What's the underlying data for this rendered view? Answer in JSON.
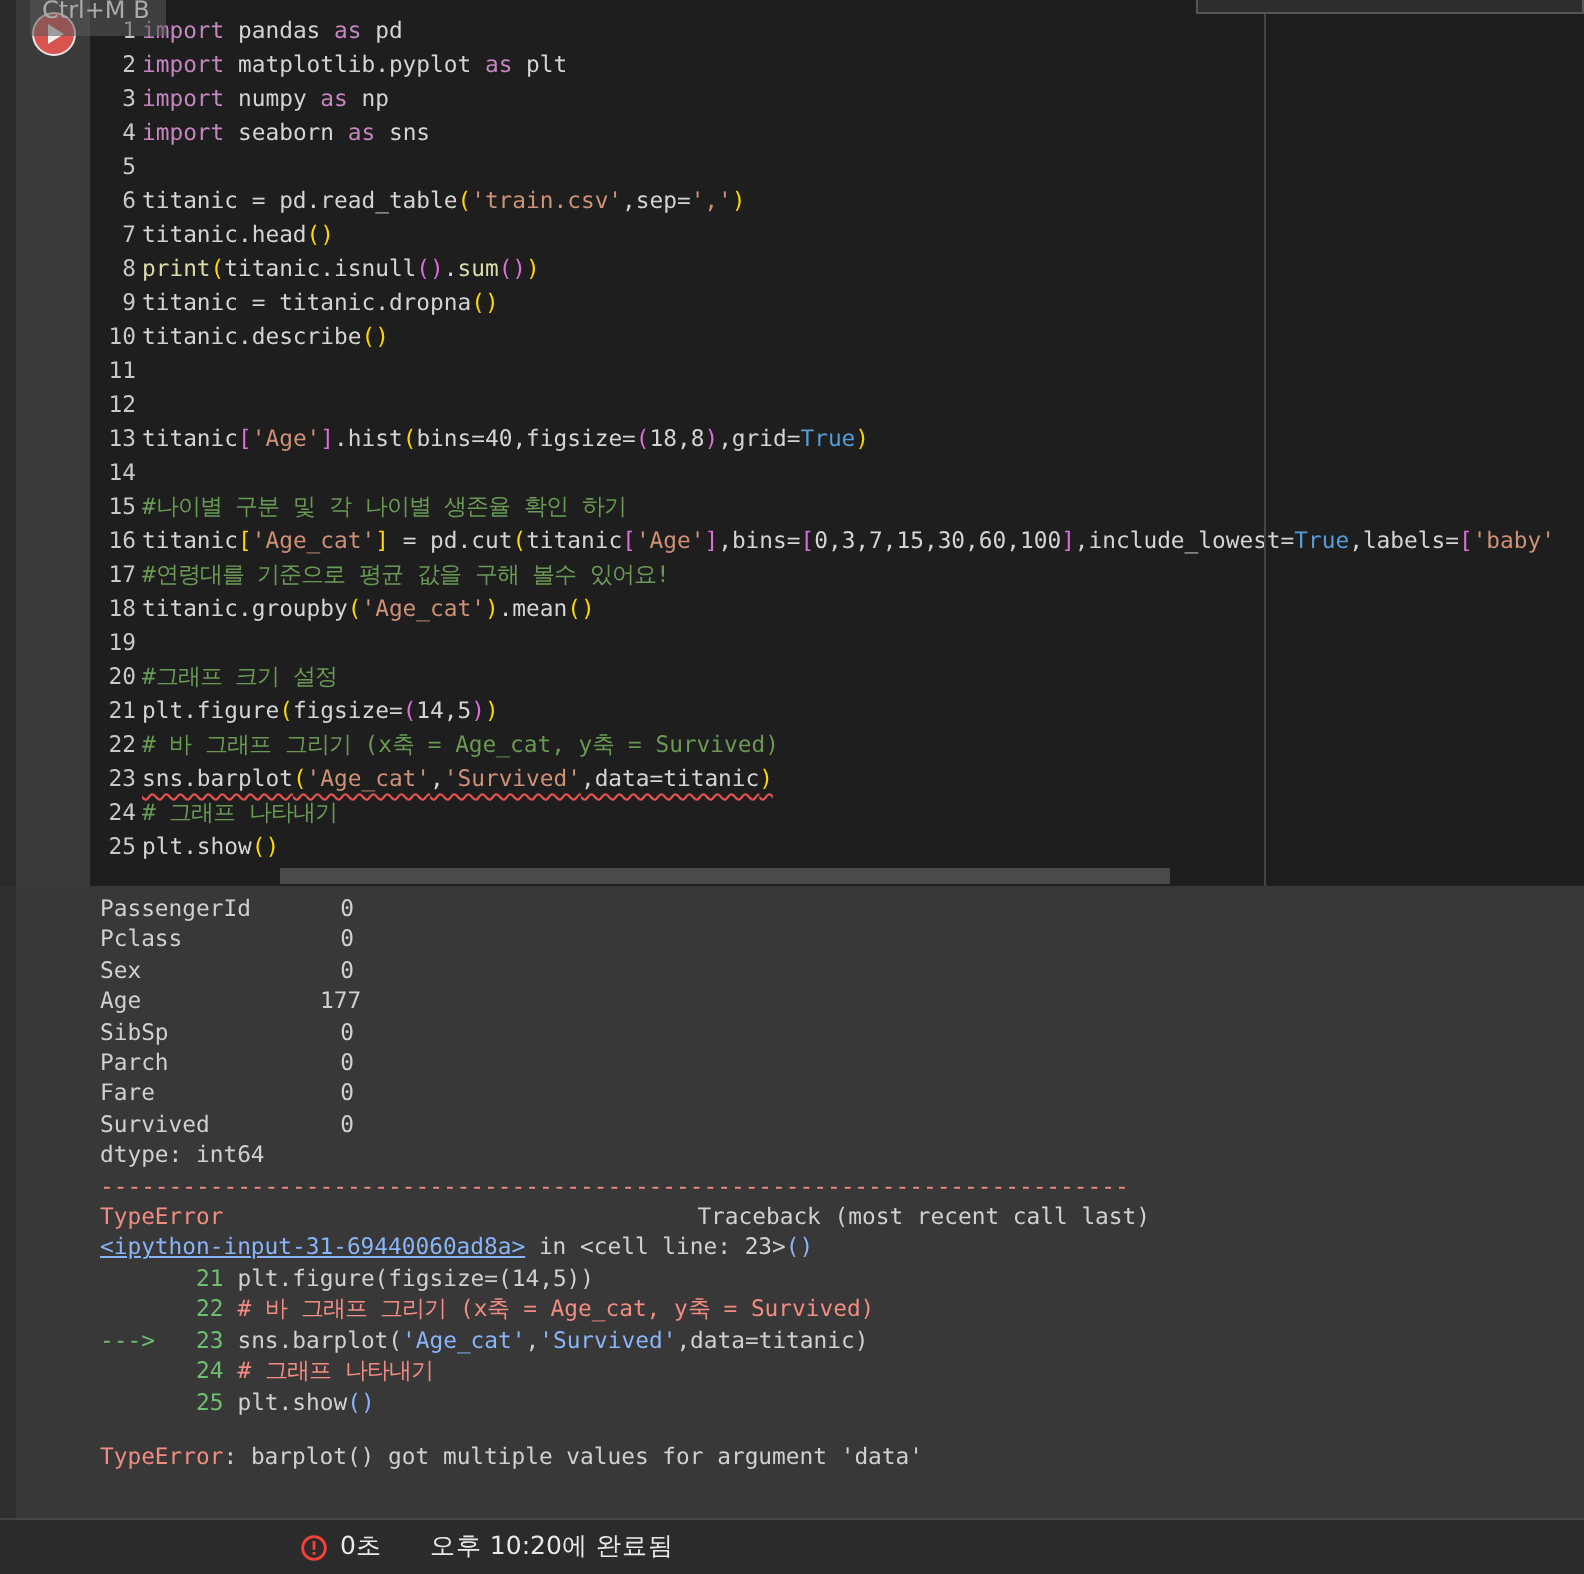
{
  "tooltip": "Ctrl+M B",
  "code_lines": [
    {
      "num": "1",
      "squiggle": false,
      "tokens": [
        {
          "kind": "kw",
          "text": "import"
        },
        {
          "kind": "plain",
          "text": " pandas "
        },
        {
          "kind": "kw",
          "text": "as"
        },
        {
          "kind": "plain",
          "text": " pd"
        }
      ]
    },
    {
      "num": "2",
      "squiggle": false,
      "tokens": [
        {
          "kind": "kw",
          "text": "import"
        },
        {
          "kind": "plain",
          "text": " matplotlib.pyplot "
        },
        {
          "kind": "kw",
          "text": "as"
        },
        {
          "kind": "plain",
          "text": " plt"
        }
      ]
    },
    {
      "num": "3",
      "squiggle": false,
      "tokens": [
        {
          "kind": "kw",
          "text": "import"
        },
        {
          "kind": "plain",
          "text": " numpy "
        },
        {
          "kind": "kw",
          "text": "as"
        },
        {
          "kind": "plain",
          "text": " np"
        }
      ]
    },
    {
      "num": "4",
      "squiggle": false,
      "tokens": [
        {
          "kind": "kw",
          "text": "import"
        },
        {
          "kind": "plain",
          "text": " seaborn "
        },
        {
          "kind": "kw",
          "text": "as"
        },
        {
          "kind": "plain",
          "text": " sns"
        }
      ]
    },
    {
      "num": "5"
    },
    {
      "num": "6",
      "squiggle": false,
      "tokens": [
        {
          "kind": "plain",
          "text": "titanic = pd.read_table"
        },
        {
          "kind": "p1",
          "text": "("
        },
        {
          "kind": "str",
          "text": "'train.csv'"
        },
        {
          "kind": "plain",
          "text": ",sep="
        },
        {
          "kind": "str",
          "text": "','"
        },
        {
          "kind": "p1",
          "text": ")"
        }
      ]
    },
    {
      "num": "7",
      "squiggle": false,
      "tokens": [
        {
          "kind": "plain",
          "text": "titanic.head"
        },
        {
          "kind": "p1",
          "text": "()"
        }
      ]
    },
    {
      "num": "8",
      "squiggle": false,
      "tokens": [
        {
          "kind": "fn",
          "text": "print"
        },
        {
          "kind": "p1",
          "text": "("
        },
        {
          "kind": "plain",
          "text": "titanic.isnull"
        },
        {
          "kind": "p2",
          "text": "()"
        },
        {
          "kind": "plain",
          "text": "."
        },
        {
          "kind": "fn",
          "text": "sum"
        },
        {
          "kind": "p2",
          "text": "()"
        },
        {
          "kind": "p1",
          "text": ")"
        }
      ]
    },
    {
      "num": "9",
      "squiggle": false,
      "tokens": [
        {
          "kind": "plain",
          "text": "titanic = titanic.dropna"
        },
        {
          "kind": "p1",
          "text": "()"
        }
      ]
    },
    {
      "num": "10",
      "squiggle": false,
      "tokens": [
        {
          "kind": "plain",
          "text": "titanic.describe"
        },
        {
          "kind": "p1",
          "text": "()"
        }
      ]
    },
    {
      "num": "11"
    },
    {
      "num": "12"
    },
    {
      "num": "13",
      "squiggle": false,
      "tokens": [
        {
          "kind": "plain",
          "text": "titanic"
        },
        {
          "kind": "p2",
          "text": "["
        },
        {
          "kind": "str",
          "text": "'Age'"
        },
        {
          "kind": "p2",
          "text": "]"
        },
        {
          "kind": "plain",
          "text": ".hist"
        },
        {
          "kind": "p1",
          "text": "("
        },
        {
          "kind": "plain",
          "text": "bins=40,figsize="
        },
        {
          "kind": "p2",
          "text": "("
        },
        {
          "kind": "plain",
          "text": "18,8"
        },
        {
          "kind": "p2",
          "text": ")"
        },
        {
          "kind": "plain",
          "text": ",grid="
        },
        {
          "kind": "bool",
          "text": "True"
        },
        {
          "kind": "p1",
          "text": ")"
        }
      ]
    },
    {
      "num": "14"
    },
    {
      "num": "15",
      "squiggle": false,
      "tokens": [
        {
          "kind": "com",
          "text": "#나이별 구분 및 각 나이별 생존율 확인 하기"
        }
      ]
    },
    {
      "num": "16",
      "squiggle": false,
      "tokens": [
        {
          "kind": "plain",
          "text": "titanic"
        },
        {
          "kind": "p1",
          "text": "["
        },
        {
          "kind": "str",
          "text": "'Age_cat'"
        },
        {
          "kind": "p1",
          "text": "]"
        },
        {
          "kind": "plain",
          "text": " = pd.cut"
        },
        {
          "kind": "p1",
          "text": "("
        },
        {
          "kind": "plain",
          "text": "titanic"
        },
        {
          "kind": "p2",
          "text": "["
        },
        {
          "kind": "str",
          "text": "'Age'"
        },
        {
          "kind": "p2",
          "text": "]"
        },
        {
          "kind": "plain",
          "text": ",bins="
        },
        {
          "kind": "p2",
          "text": "["
        },
        {
          "kind": "plain",
          "text": "0,3,7,15,30,60,100"
        },
        {
          "kind": "p2",
          "text": "]"
        },
        {
          "kind": "plain",
          "text": ",include_lowest="
        },
        {
          "kind": "bool",
          "text": "True"
        },
        {
          "kind": "plain",
          "text": ",labels="
        },
        {
          "kind": "p2",
          "text": "["
        },
        {
          "kind": "str",
          "text": "'baby'"
        }
      ]
    },
    {
      "num": "17",
      "squiggle": false,
      "tokens": [
        {
          "kind": "com",
          "text": "#연령대를 기준으로 평균 값을 구해 볼수 있어요!"
        }
      ]
    },
    {
      "num": "18",
      "squiggle": false,
      "tokens": [
        {
          "kind": "plain",
          "text": "titanic.groupby"
        },
        {
          "kind": "p1",
          "text": "("
        },
        {
          "kind": "str",
          "text": "'Age_cat'"
        },
        {
          "kind": "p1",
          "text": ")"
        },
        {
          "kind": "plain",
          "text": ".mean"
        },
        {
          "kind": "p1",
          "text": "()"
        }
      ]
    },
    {
      "num": "19"
    },
    {
      "num": "20",
      "squiggle": false,
      "tokens": [
        {
          "kind": "com",
          "text": "#그래프 크기 설정"
        }
      ]
    },
    {
      "num": "21",
      "squiggle": false,
      "tokens": [
        {
          "kind": "plain",
          "text": "plt.figure"
        },
        {
          "kind": "p1",
          "text": "("
        },
        {
          "kind": "plain",
          "text": "figsize="
        },
        {
          "kind": "p2",
          "text": "("
        },
        {
          "kind": "plain",
          "text": "14,5"
        },
        {
          "kind": "p2",
          "text": ")"
        },
        {
          "kind": "p1",
          "text": ")"
        }
      ]
    },
    {
      "num": "22",
      "squiggle": false,
      "tokens": [
        {
          "kind": "com",
          "text": "# 바 그래프 그리기 (x축 = Age_cat, y축 = Survived)"
        }
      ]
    },
    {
      "num": "23",
      "squiggle": true,
      "tokens": [
        {
          "kind": "plain",
          "text": "sns.barplot"
        },
        {
          "kind": "p1",
          "text": "("
        },
        {
          "kind": "str",
          "text": "'Age_cat'"
        },
        {
          "kind": "plain",
          "text": ","
        },
        {
          "kind": "str",
          "text": "'Survived'"
        },
        {
          "kind": "plain",
          "text": ",data=titanic"
        },
        {
          "kind": "p1",
          "text": ")"
        }
      ]
    },
    {
      "num": "24",
      "squiggle": false,
      "tokens": [
        {
          "kind": "com",
          "text": "# 그래프 나타내기"
        }
      ]
    },
    {
      "num": "25",
      "squiggle": false,
      "tokens": [
        {
          "kind": "plain",
          "text": "plt.show"
        },
        {
          "kind": "p1",
          "text": "()"
        }
      ]
    }
  ],
  "output": {
    "series": [
      {
        "name": "PassengerId",
        "value": "0"
      },
      {
        "name": "Pclass",
        "value": "0"
      },
      {
        "name": "Sex",
        "value": "0"
      },
      {
        "name": "Age",
        "value": "177"
      },
      {
        "name": "SibSp",
        "value": "0"
      },
      {
        "name": "Parch",
        "value": "0"
      },
      {
        "name": "Fare",
        "value": "0"
      },
      {
        "name": "Survived",
        "value": "0"
      }
    ],
    "dtype": "dtype: int64",
    "separator": "---------------------------------------------------------------------------",
    "error_name": "TypeError",
    "traceback_header": "Traceback (most recent call last)",
    "link": "<ipython-input-31-69440060ad8a>",
    "location": [
      {
        "kind": "plain",
        "text": " in <cell line: 23>"
      },
      {
        "kind": "blue",
        "text": "()"
      }
    ],
    "context": [
      {
        "num": "21",
        "tokens": [
          {
            "kind": "plain",
            "text": "plt.figure(figsize=(14,5))"
          }
        ]
      },
      {
        "num": "22",
        "tokens": [
          {
            "kind": "red",
            "text": "# 바 그래프 그리기 (x축 = Age_cat, y축 = Survived)"
          }
        ]
      },
      {
        "marker": "--->",
        "num": "23",
        "tokens": [
          {
            "kind": "plain",
            "text": "sns.barplot("
          },
          {
            "kind": "blue",
            "text": "'Age_cat'"
          },
          {
            "kind": "plain",
            "text": ","
          },
          {
            "kind": "blue",
            "text": "'Survived'"
          },
          {
            "kind": "plain",
            "text": ",data=titanic)"
          }
        ]
      },
      {
        "num": "24",
        "tokens": [
          {
            "kind": "red",
            "text": "# 그래프 나타내기"
          }
        ]
      },
      {
        "num": "25",
        "tokens": [
          {
            "kind": "plain",
            "text": "plt.show"
          },
          {
            "kind": "blue",
            "text": "()"
          }
        ]
      }
    ],
    "message": [
      {
        "kind": "red",
        "text": "TypeError"
      },
      {
        "kind": "plain",
        "text": ": barplot() got multiple values for argument 'data'"
      }
    ]
  },
  "status_bar": {
    "duration": "0초",
    "completed": "오후 10:20에 완료됨"
  }
}
